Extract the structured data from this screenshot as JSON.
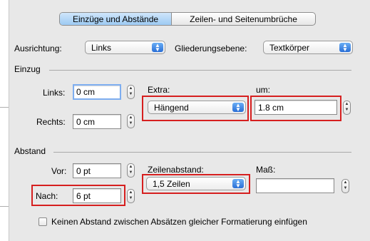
{
  "tabs": [
    {
      "label": "Einzüge und Abstände",
      "selected": true
    },
    {
      "label": "Zeilen- und Seitenumbrüche",
      "selected": false
    }
  ],
  "alignment": {
    "label": "Ausrichtung:",
    "value": "Links"
  },
  "outline": {
    "label": "Gliederungsebene:",
    "value": "Textkörper"
  },
  "indent": {
    "section": "Einzug",
    "left_label": "Links:",
    "left_value": "0 cm",
    "right_label": "Rechts:",
    "right_value": "0 cm",
    "extra_label": "Extra:",
    "extra_value": "Hängend",
    "by_label": "um:",
    "by_value": "1.8 cm"
  },
  "spacing": {
    "section": "Abstand",
    "before_label": "Vor:",
    "before_value": "0 pt",
    "after_label": "Nach:",
    "after_value": "6 pt",
    "line_label": "Zeilenabstand:",
    "line_value": "1,5 Zeilen",
    "at_label": "Maß:",
    "at_value": ""
  },
  "checkbox_label": "Keinen Abstand zwischen Absätzen gleicher Formatierung einfügen",
  "colors": {
    "highlight": "#d61f1f",
    "accent": "#3b82e6"
  }
}
